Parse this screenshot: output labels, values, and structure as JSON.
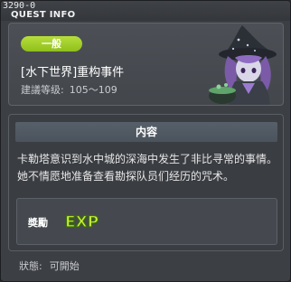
{
  "window": {
    "quest_id": "3290-0",
    "title": "QUEST INFO"
  },
  "header": {
    "category_badge": "一般",
    "quest_name": "[水下世界]重构事件",
    "level_label": "建議等级:",
    "level_range": "105～109",
    "npc_icon": "witch-npc-portrait"
  },
  "content": {
    "section_title": "内容",
    "description": "卡勒塔意识到水中城的深海中发生了非比寻常的事情。她不情愿地准备查看勘探队员们经历的咒术。",
    "reward_label": "奬勵",
    "reward_icon": "exp-icon",
    "reward_icon_text": "EXP"
  },
  "status": {
    "label": "狀態:",
    "value": "可開始"
  },
  "colors": {
    "badge": "#9acb24",
    "exp_text": "#c8f03a",
    "window_bg": "#3c3f44"
  }
}
